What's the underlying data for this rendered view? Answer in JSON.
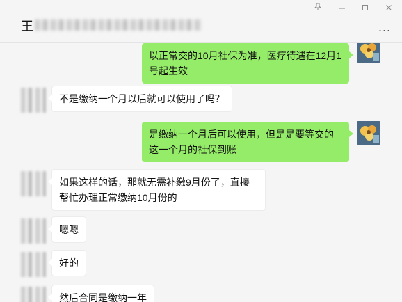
{
  "window": {
    "title": "王",
    "pin_icon": "pin-icon",
    "minimize_icon": "minimize-icon",
    "maximize_icon": "maximize-icon",
    "close_icon": "close-icon"
  },
  "header": {
    "more_label": "..."
  },
  "messages": [
    {
      "side": "right",
      "text": "以正常交的10月社保为准，医疗待遇在12月1号起生效"
    },
    {
      "side": "left",
      "text": "不是缴纳一个月以后就可以使用了吗？"
    },
    {
      "side": "right",
      "text": "是缴纳一个月后可以使用，但是是要等交的这一个月的社保到账"
    },
    {
      "side": "left",
      "text": "如果这样的话，那就无需补缴9月份了，直接帮忙办理正常缴纳10月份的"
    },
    {
      "side": "left",
      "text": "嗯嗯"
    },
    {
      "side": "left",
      "text": "好的"
    },
    {
      "side": "left",
      "text": "然后合同是缴纳一年"
    }
  ],
  "colors": {
    "outgoing_bubble": "#95ec69",
    "incoming_bubble": "#ffffff",
    "background": "#f5f5f5"
  }
}
